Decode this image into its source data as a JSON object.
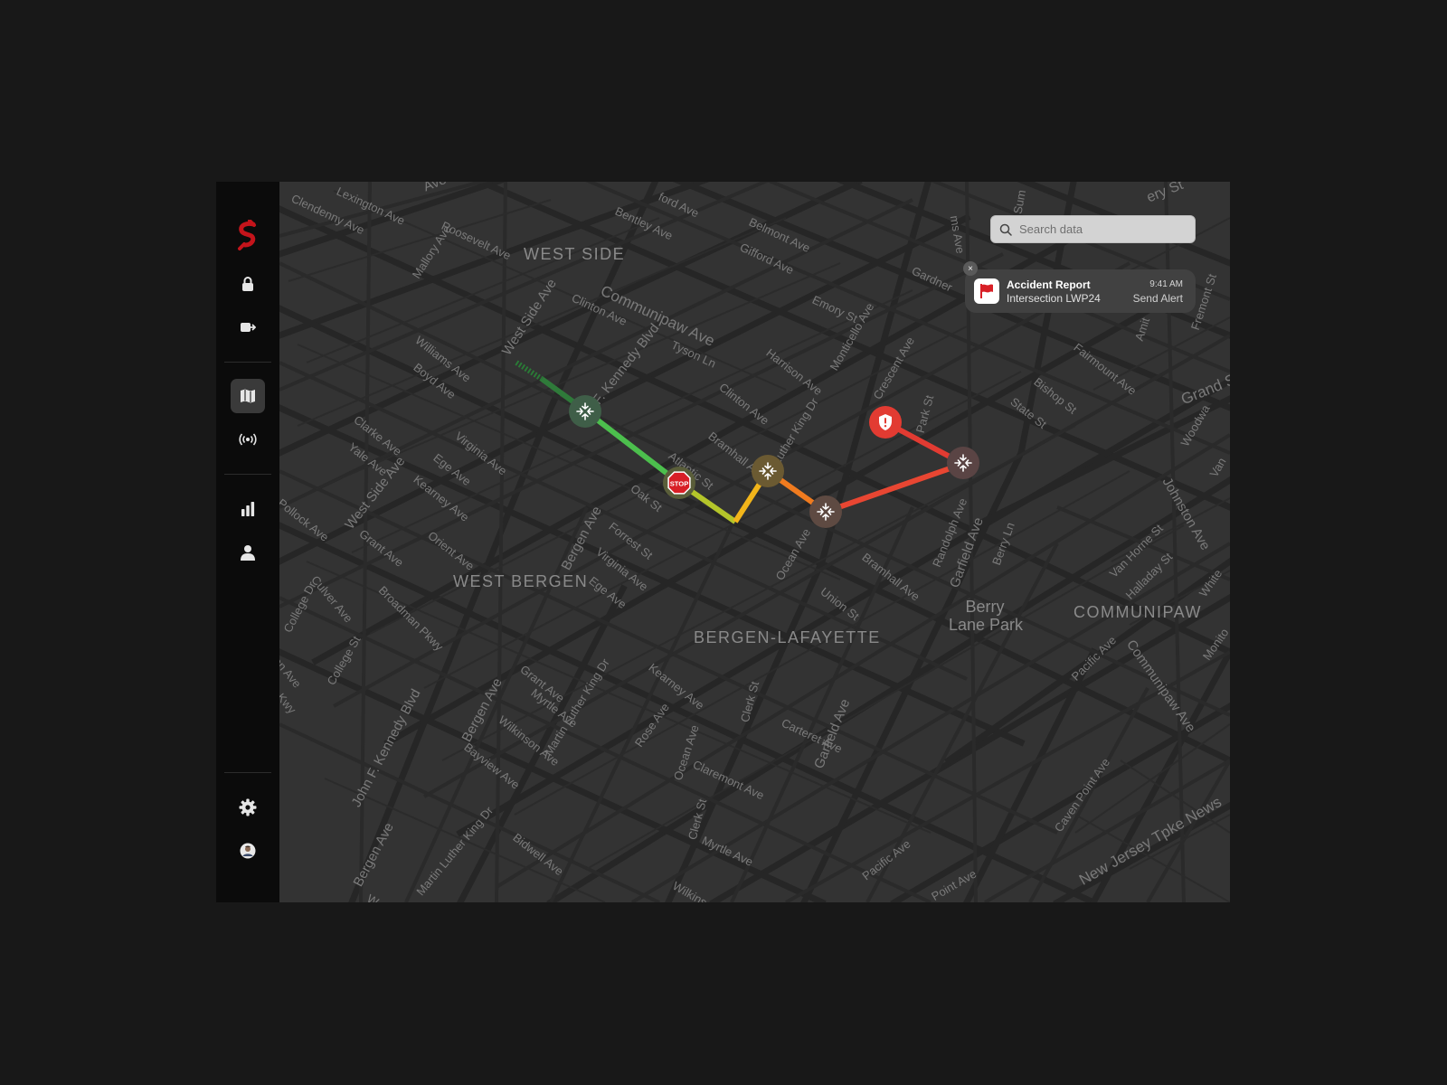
{
  "sidebar": {
    "logo": "brand-logo",
    "accent_color": "#c4141b",
    "items": [
      {
        "name": "lock",
        "icon": "lock-icon"
      },
      {
        "name": "export",
        "icon": "export-icon"
      },
      {
        "name": "map",
        "icon": "map-icon",
        "active": true
      },
      {
        "name": "broadcast",
        "icon": "broadcast-icon"
      },
      {
        "name": "analytics",
        "icon": "bar-chart-icon"
      },
      {
        "name": "user",
        "icon": "user-icon"
      },
      {
        "name": "settings",
        "icon": "gear-icon"
      },
      {
        "name": "profile",
        "icon": "avatar"
      }
    ]
  },
  "search": {
    "placeholder": "Search data"
  },
  "alert": {
    "title": "Accident Report",
    "subtitle": "Intersection LWP24",
    "time": "9:41 AM",
    "action": "Send Alert",
    "close": "×"
  },
  "map": {
    "districts": {
      "west_side": "WEST SIDE",
      "west_bergen": "WEST BERGEN",
      "bergen_lafayette": "BERGEN-LAFAYETTE",
      "communipaw": "COMMUNIPAW",
      "berry_lane_park_1": "Berry",
      "berry_lane_park_2": "Lane Park"
    },
    "streets": [
      "Clendenny Ave",
      "Lexington Ave",
      "Ave",
      "Roosevelt Ave",
      "Mallory Ave",
      "Bentley Ave",
      "ford Ave",
      "Belmont Ave",
      "Gifford Ave",
      "Gardner",
      "Emory St",
      "Sum",
      "ms Ave",
      "ery St",
      "Communipaw Ave",
      "Clinton Ave",
      "Tyson Ln",
      "West Side Ave",
      "Williams Ave",
      "Boyd Ave",
      "F. Kennedy Blvd",
      "Harrison Ave",
      "Monticello Ave",
      "Crescent Ave",
      "Fairmount Ave",
      "Bishop St",
      "State St",
      "Grand S",
      "Fremont St",
      "Amit",
      "Clinton Ave",
      "Bramhall Ave",
      "Luther King Dr",
      "Park St",
      "Atlantic St",
      "Clarke Ave",
      "Yale Ave",
      "Virginia Ave",
      "Ege Ave",
      "West Side Ave",
      "Kearney Ave",
      "Oak St",
      "Johnston Ave",
      "Woodwa",
      "Van",
      "Pollock Ave",
      "Grant Ave",
      "Orient Ave",
      "Bergen Ave",
      "Forrest St",
      "Virginia Ave",
      "Ocean Ave",
      "Randolph Ave",
      "Garfield Ave",
      "Berry Ln",
      "Bramhall Ave",
      "Van Horne St",
      "Halladay St",
      "White",
      "Culver Ave",
      "College Dr",
      "Broadman Pkwy",
      "Ege Ave",
      "Union St",
      "Pacific Ave",
      "Communipaw Ave",
      "Monito",
      "College St",
      "on Ave",
      "Kwy",
      "Grant Ave",
      "Myrtle Ave",
      "Bergen Ave",
      "Martin Luther King Dr",
      "Kearney Ave",
      "Rose Ave",
      "Clerk St",
      "Carteret Ave",
      "Garfield Ave",
      "John F. Kennedy Blvd",
      "Wilkinson Ave",
      "Bayview Ave",
      "Ocean Ave",
      "Claremont Ave",
      "Clerk St",
      "Caven Point Ave",
      "Myrtle Ave",
      "Bergen Ave",
      "Martin Luther King Dr",
      "Bidwell Ave",
      "Pacific Ave",
      "New Jersey Tpke News",
      "Point Ave",
      "Wilkinson",
      "W"
    ]
  },
  "route": {
    "segment_colors": [
      "#2f7a3a",
      "#4cbf4d",
      "#9ccc2e",
      "#f2b51a",
      "#f07b1f",
      "#e84632",
      "#e23b32"
    ],
    "markers": [
      {
        "type": "merge",
        "icon": "merge-arrows-icon",
        "color": "#3f5e48"
      },
      {
        "type": "stop",
        "icon": "stop-sign-icon",
        "color": "#5a5e3a"
      },
      {
        "type": "merge",
        "icon": "merge-arrows-icon",
        "color": "#6b5a32"
      },
      {
        "type": "merge",
        "icon": "merge-arrows-icon",
        "color": "#5e4a42"
      },
      {
        "type": "incident",
        "icon": "shield-alert-icon",
        "color": "#e23b32"
      },
      {
        "type": "merge",
        "icon": "merge-arrows-icon",
        "color": "#5a4444"
      }
    ]
  }
}
